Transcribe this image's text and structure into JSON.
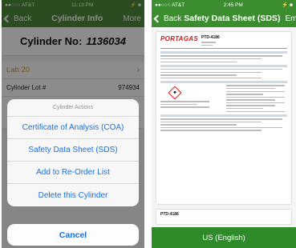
{
  "left": {
    "status": {
      "carrier": "●●○○○ AT&T",
      "time": "11:13 PM",
      "battery": "⚡ ■"
    },
    "nav": {
      "back": "Back",
      "title": "Cylinder Info",
      "more": "More"
    },
    "cylinder": {
      "label": "Cylinder No:",
      "number": "1136034"
    },
    "rows": {
      "lab": "Lab 20",
      "lot_label": "Cylinder Lot #",
      "lot_value": "974934"
    },
    "sheet": {
      "title": "Cylinder Actions",
      "items": [
        "Certificate of Analysis (COA)",
        "Safety Data Sheet (SDS)",
        "Add to Re-Order List",
        "Delete this Cylinder"
      ],
      "cancel": "Cancel"
    }
  },
  "right": {
    "status": {
      "carrier": "●●○○○ AT&T",
      "time": "2:45 PM",
      "battery": "⚡ ■"
    },
    "nav": {
      "back": "Back",
      "title": "Safety Data Sheet (SDS)",
      "extra": "Ema"
    },
    "doc": {
      "logo": "PORTAGAS",
      "code": "PTD-4186",
      "code2": "PTD-4186"
    },
    "language": "US (English)"
  },
  "colors": {
    "left_green": "#4f8a3b",
    "right_green": "#3c8d2f",
    "link_blue": "#1a6fdc",
    "lab_orange": "#e39b1a"
  }
}
